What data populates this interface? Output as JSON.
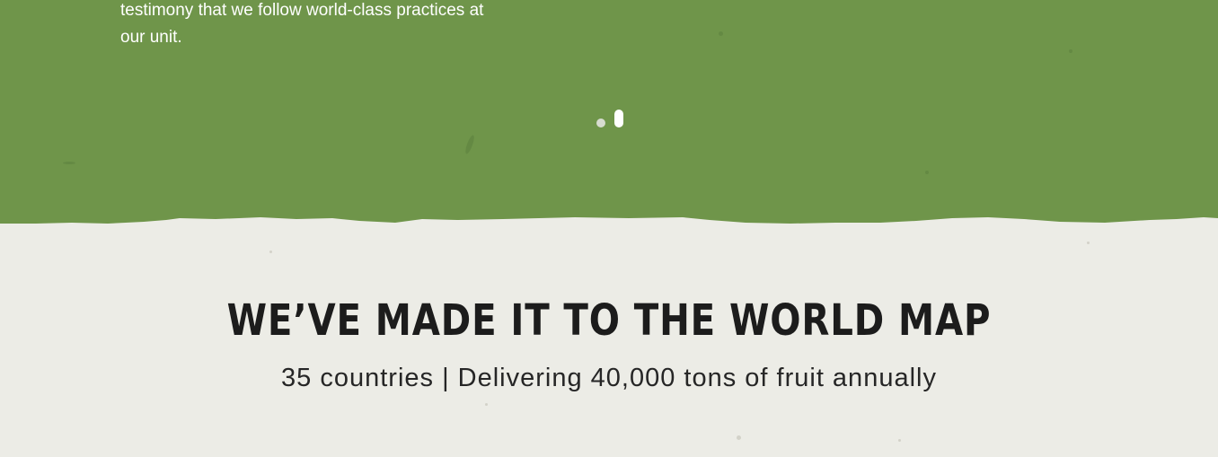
{
  "testimony": {
    "text_line_1": "testimony that we follow world-class practices at",
    "text_line_2": "our unit."
  },
  "carousel": {
    "dot_count": 2,
    "active_index": 1
  },
  "world_map": {
    "heading": "We’ve made it to the world map",
    "subheading": "35 countries | Delivering 40,000 tons of fruit annually"
  },
  "colors": {
    "green_background": "#6f954a",
    "cream_background": "#ecece6",
    "heading_text": "#1c1c1c",
    "body_text_on_green": "#ffffff"
  }
}
